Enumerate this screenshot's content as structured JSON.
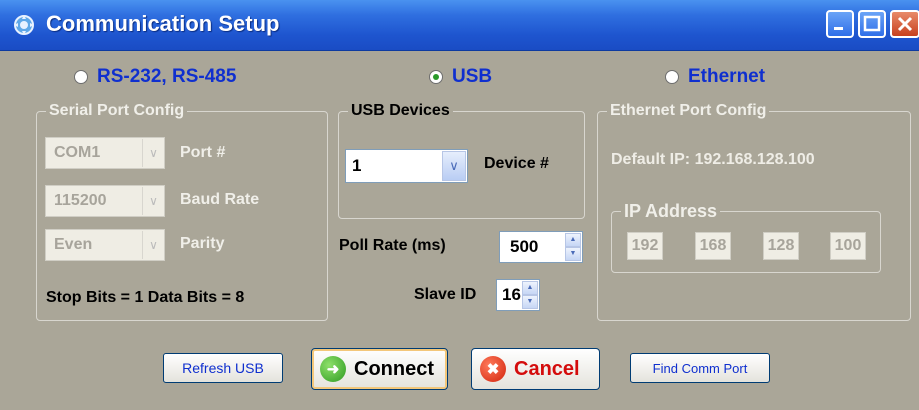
{
  "window": {
    "title": "Communication Setup",
    "colors": {
      "titlebar": "#2f6fe0",
      "client": "#aaa698",
      "accent_text": "#0f2fcf",
      "close_button": "#c8411e"
    }
  },
  "interface_options": [
    {
      "label": "RS-232, RS-485",
      "selected": false
    },
    {
      "label": "USB",
      "selected": true
    },
    {
      "label": "Ethernet",
      "selected": false
    }
  ],
  "serial": {
    "title": "Serial Port Config",
    "port": {
      "value": "COM1",
      "label": "Port #"
    },
    "baud": {
      "value": "115200",
      "label": "Baud Rate"
    },
    "parity": {
      "value": "Even",
      "label": "Parity"
    },
    "bits_text": "Stop Bits = 1 Data Bits = 8"
  },
  "usb": {
    "title": "USB Devices",
    "device": {
      "value": "1",
      "label": "Device #"
    }
  },
  "poll": {
    "label": "Poll Rate (ms)",
    "value": "500"
  },
  "slave": {
    "label": "Slave ID",
    "value": "16"
  },
  "ethernet": {
    "title": "Ethernet Port Config",
    "default_ip_text": "Default IP: 192.168.128.100",
    "ip_title": "IP Address",
    "octets": [
      "192",
      "168",
      "128",
      "100"
    ]
  },
  "buttons": {
    "refresh": "Refresh USB",
    "connect": "Connect",
    "cancel": "Cancel",
    "find": "Find Comm Port"
  },
  "icons": {
    "app": "gear-network-icon",
    "connect": "arrow-right-circle-icon",
    "cancel": "x-circle-icon"
  }
}
